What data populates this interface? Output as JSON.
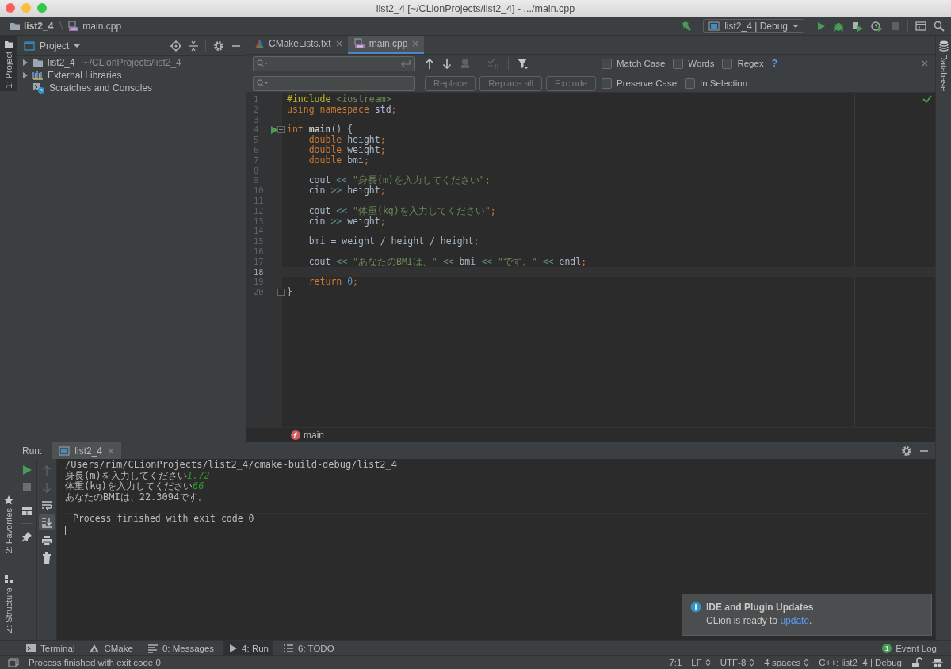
{
  "window": {
    "title": "list2_4 [~/CLionProjects/list2_4] - .../main.cpp"
  },
  "navigation_bar": {
    "breadcrumbs": [
      {
        "label": "list2_4",
        "kind": "folder"
      },
      {
        "label": "main.cpp",
        "kind": "cpp"
      }
    ],
    "run_configuration": "list2_4 | Debug"
  },
  "left_tool_strip": [
    {
      "label": "1: Project",
      "kind": "project",
      "selected": true
    },
    {
      "label": "2: Favorites",
      "kind": "favorites",
      "selected": false
    },
    {
      "label": "Z: Structure",
      "kind": "structure",
      "selected": false
    }
  ],
  "right_tool_strip": [
    {
      "label": "Database",
      "selected": false
    }
  ],
  "project_panel": {
    "title": "Project",
    "items": [
      {
        "label": "list2_4",
        "path": "~/CLionProjects/list2_4",
        "kind": "folder",
        "expandable": true,
        "expanded": false
      },
      {
        "label": "External Libraries",
        "kind": "library",
        "expandable": true,
        "expanded": false
      },
      {
        "label": "Scratches and Consoles",
        "kind": "scratches",
        "expandable": false
      }
    ]
  },
  "editor_tabs": [
    {
      "label": "CMakeLists.txt",
      "kind": "cmake",
      "selected": false
    },
    {
      "label": "main.cpp",
      "kind": "cpp",
      "selected": true
    }
  ],
  "find_bar": {
    "search_options": [
      {
        "label": "Match Case",
        "checked": false
      },
      {
        "label": "Words",
        "checked": false
      },
      {
        "label": "Regex",
        "checked": false
      }
    ],
    "help": "?",
    "buttons": [
      {
        "label": "Replace",
        "disabled": true
      },
      {
        "label": "Replace all",
        "disabled": true
      },
      {
        "label": "Exclude",
        "disabled": true
      }
    ],
    "replace_options": [
      {
        "label": "Preserve Case",
        "checked": false
      },
      {
        "label": "In Selection",
        "checked": false
      }
    ]
  },
  "editor": {
    "lines": [
      {
        "number": "1",
        "run": false,
        "fold": false,
        "current": false,
        "tokens": [
          {
            "kind": "directive",
            "text": "#include"
          },
          {
            "kind": "include",
            "text": " <iostream>"
          }
        ]
      },
      {
        "number": "2",
        "run": false,
        "fold": false,
        "current": false,
        "tokens": [
          {
            "kind": "keyword",
            "text": "using"
          },
          {
            "kind": "keyword",
            "text": " namespace"
          },
          {
            "kind": "namespace",
            "text": " std"
          },
          {
            "kind": "punct",
            "text": ";"
          }
        ]
      },
      {
        "number": "3",
        "run": false,
        "fold": false,
        "current": false
      },
      {
        "number": "4",
        "run": true,
        "fold": true,
        "current": false,
        "tokens": [
          {
            "kind": "keyword",
            "text": "int"
          },
          {
            "kind": "func",
            "text": " main"
          },
          {
            "kind": "plain",
            "text": "() {"
          }
        ]
      },
      {
        "number": "5",
        "run": false,
        "fold": false,
        "current": false,
        "tokens": [
          {
            "kind": "keyword",
            "text": "    double"
          },
          {
            "kind": "plain",
            "text": " height"
          },
          {
            "kind": "punct",
            "text": ";"
          }
        ]
      },
      {
        "number": "6",
        "run": false,
        "fold": false,
        "current": false,
        "tokens": [
          {
            "kind": "keyword",
            "text": "    double"
          },
          {
            "kind": "plain",
            "text": " weight"
          },
          {
            "kind": "punct",
            "text": ";"
          }
        ]
      },
      {
        "number": "7",
        "run": false,
        "fold": false,
        "current": false,
        "tokens": [
          {
            "kind": "keyword",
            "text": "    double"
          },
          {
            "kind": "plain",
            "text": " bmi"
          },
          {
            "kind": "punct",
            "text": ";"
          }
        ]
      },
      {
        "number": "8",
        "run": false,
        "fold": false,
        "current": false
      },
      {
        "number": "9",
        "run": false,
        "fold": false,
        "current": false,
        "tokens": [
          {
            "kind": "plain",
            "text": "    cout "
          },
          {
            "kind": "op",
            "text": "<<"
          },
          {
            "kind": "string",
            "text": " \"身長(m)を入力してください\""
          },
          {
            "kind": "punct",
            "text": ";"
          }
        ]
      },
      {
        "number": "10",
        "run": false,
        "fold": false,
        "current": false,
        "tokens": [
          {
            "kind": "plain",
            "text": "    cin "
          },
          {
            "kind": "op",
            "text": ">>"
          },
          {
            "kind": "plain",
            "text": " height"
          },
          {
            "kind": "punct",
            "text": ";"
          }
        ]
      },
      {
        "number": "11",
        "run": false,
        "fold": false,
        "current": false
      },
      {
        "number": "12",
        "run": false,
        "fold": false,
        "current": false,
        "tokens": [
          {
            "kind": "plain",
            "text": "    cout "
          },
          {
            "kind": "op",
            "text": "<<"
          },
          {
            "kind": "string",
            "text": " \"体重(kg)を入力してください\""
          },
          {
            "kind": "punct",
            "text": ";"
          }
        ]
      },
      {
        "number": "13",
        "run": false,
        "fold": false,
        "current": false,
        "tokens": [
          {
            "kind": "plain",
            "text": "    cin "
          },
          {
            "kind": "op",
            "text": ">>"
          },
          {
            "kind": "plain",
            "text": " weight"
          },
          {
            "kind": "punct",
            "text": ";"
          }
        ]
      },
      {
        "number": "14",
        "run": false,
        "fold": false,
        "current": false
      },
      {
        "number": "15",
        "run": false,
        "fold": false,
        "current": false,
        "tokens": [
          {
            "kind": "plain",
            "text": "    bmi = weight / height / height"
          },
          {
            "kind": "punct",
            "text": ";"
          }
        ]
      },
      {
        "number": "16",
        "run": false,
        "fold": false,
        "current": false
      },
      {
        "number": "17",
        "run": false,
        "fold": false,
        "current": false,
        "tokens": [
          {
            "kind": "plain",
            "text": "    cout "
          },
          {
            "kind": "op",
            "text": "<<"
          },
          {
            "kind": "string",
            "text": " \"あなたのBMIは、\""
          },
          {
            "kind": "op",
            "text": " <<"
          },
          {
            "kind": "plain",
            "text": " bmi "
          },
          {
            "kind": "op",
            "text": "<<"
          },
          {
            "kind": "string",
            "text": " \"です。\""
          },
          {
            "kind": "op",
            "text": " <<"
          },
          {
            "kind": "plain",
            "text": " endl"
          },
          {
            "kind": "punct",
            "text": ";"
          }
        ]
      },
      {
        "number": "18",
        "run": false,
        "fold": false,
        "current": true
      },
      {
        "number": "19",
        "run": false,
        "fold": false,
        "current": false,
        "tokens": [
          {
            "kind": "keyword",
            "text": "    return"
          },
          {
            "kind": "number",
            "text": " 0"
          },
          {
            "kind": "punct",
            "text": ";"
          }
        ]
      },
      {
        "number": "20",
        "run": false,
        "fold": true,
        "current": false,
        "tokens": [
          {
            "kind": "plain",
            "text": "}"
          }
        ]
      }
    ],
    "breadcrumb": "main"
  },
  "run_panel": {
    "label": "Run:",
    "tabs": [
      {
        "label": "list2_4",
        "selected": true
      }
    ],
    "console": [
      {
        "kind": "output",
        "segments": [
          {
            "kind": "output",
            "text": "/Users/rim/CLionProjects/list2_4/cmake-build-debug/list2_4"
          }
        ]
      },
      {
        "kind": "output",
        "segments": [
          {
            "kind": "output",
            "text": "身長(m)を入力してください"
          },
          {
            "kind": "input",
            "text": "1.72"
          }
        ]
      },
      {
        "kind": "output",
        "segments": [
          {
            "kind": "output",
            "text": "体重(kg)を入力してください"
          },
          {
            "kind": "input",
            "text": "66"
          }
        ]
      },
      {
        "kind": "output",
        "segments": [
          {
            "kind": "output",
            "text": "あなたのBMIは、22.3094です。"
          }
        ]
      },
      {
        "kind": "status",
        "segments": [
          {
            "kind": "output",
            "text": "Process finished with exit code 0"
          }
        ]
      }
    ]
  },
  "notification": {
    "title": "IDE and Plugin Updates",
    "text": "CLion is ready to ",
    "link": "update",
    "text_end": "."
  },
  "bottom_tool_tabs": [
    {
      "label": "Terminal",
      "kind": "terminal",
      "selected": false
    },
    {
      "label": "CMake",
      "kind": "cmake",
      "selected": false
    },
    {
      "label": "0: Messages",
      "kind": "messages",
      "selected": false
    },
    {
      "label": "4: Run",
      "kind": "run",
      "selected": true
    },
    {
      "label": "6: TODO",
      "kind": "todo",
      "selected": false
    }
  ],
  "event_log": {
    "label": "Event Log",
    "count": "1"
  },
  "status_bar": {
    "message": "Process finished with exit code 0",
    "items": [
      {
        "label": "7:1",
        "kind": "plain"
      },
      {
        "label": "LF",
        "kind": "dropdown"
      },
      {
        "label": "UTF-8",
        "kind": "dropdown"
      },
      {
        "label": "4 spaces",
        "kind": "dropdown"
      },
      {
        "label": "C++: list2_4 | Debug",
        "kind": "plain"
      }
    ]
  }
}
